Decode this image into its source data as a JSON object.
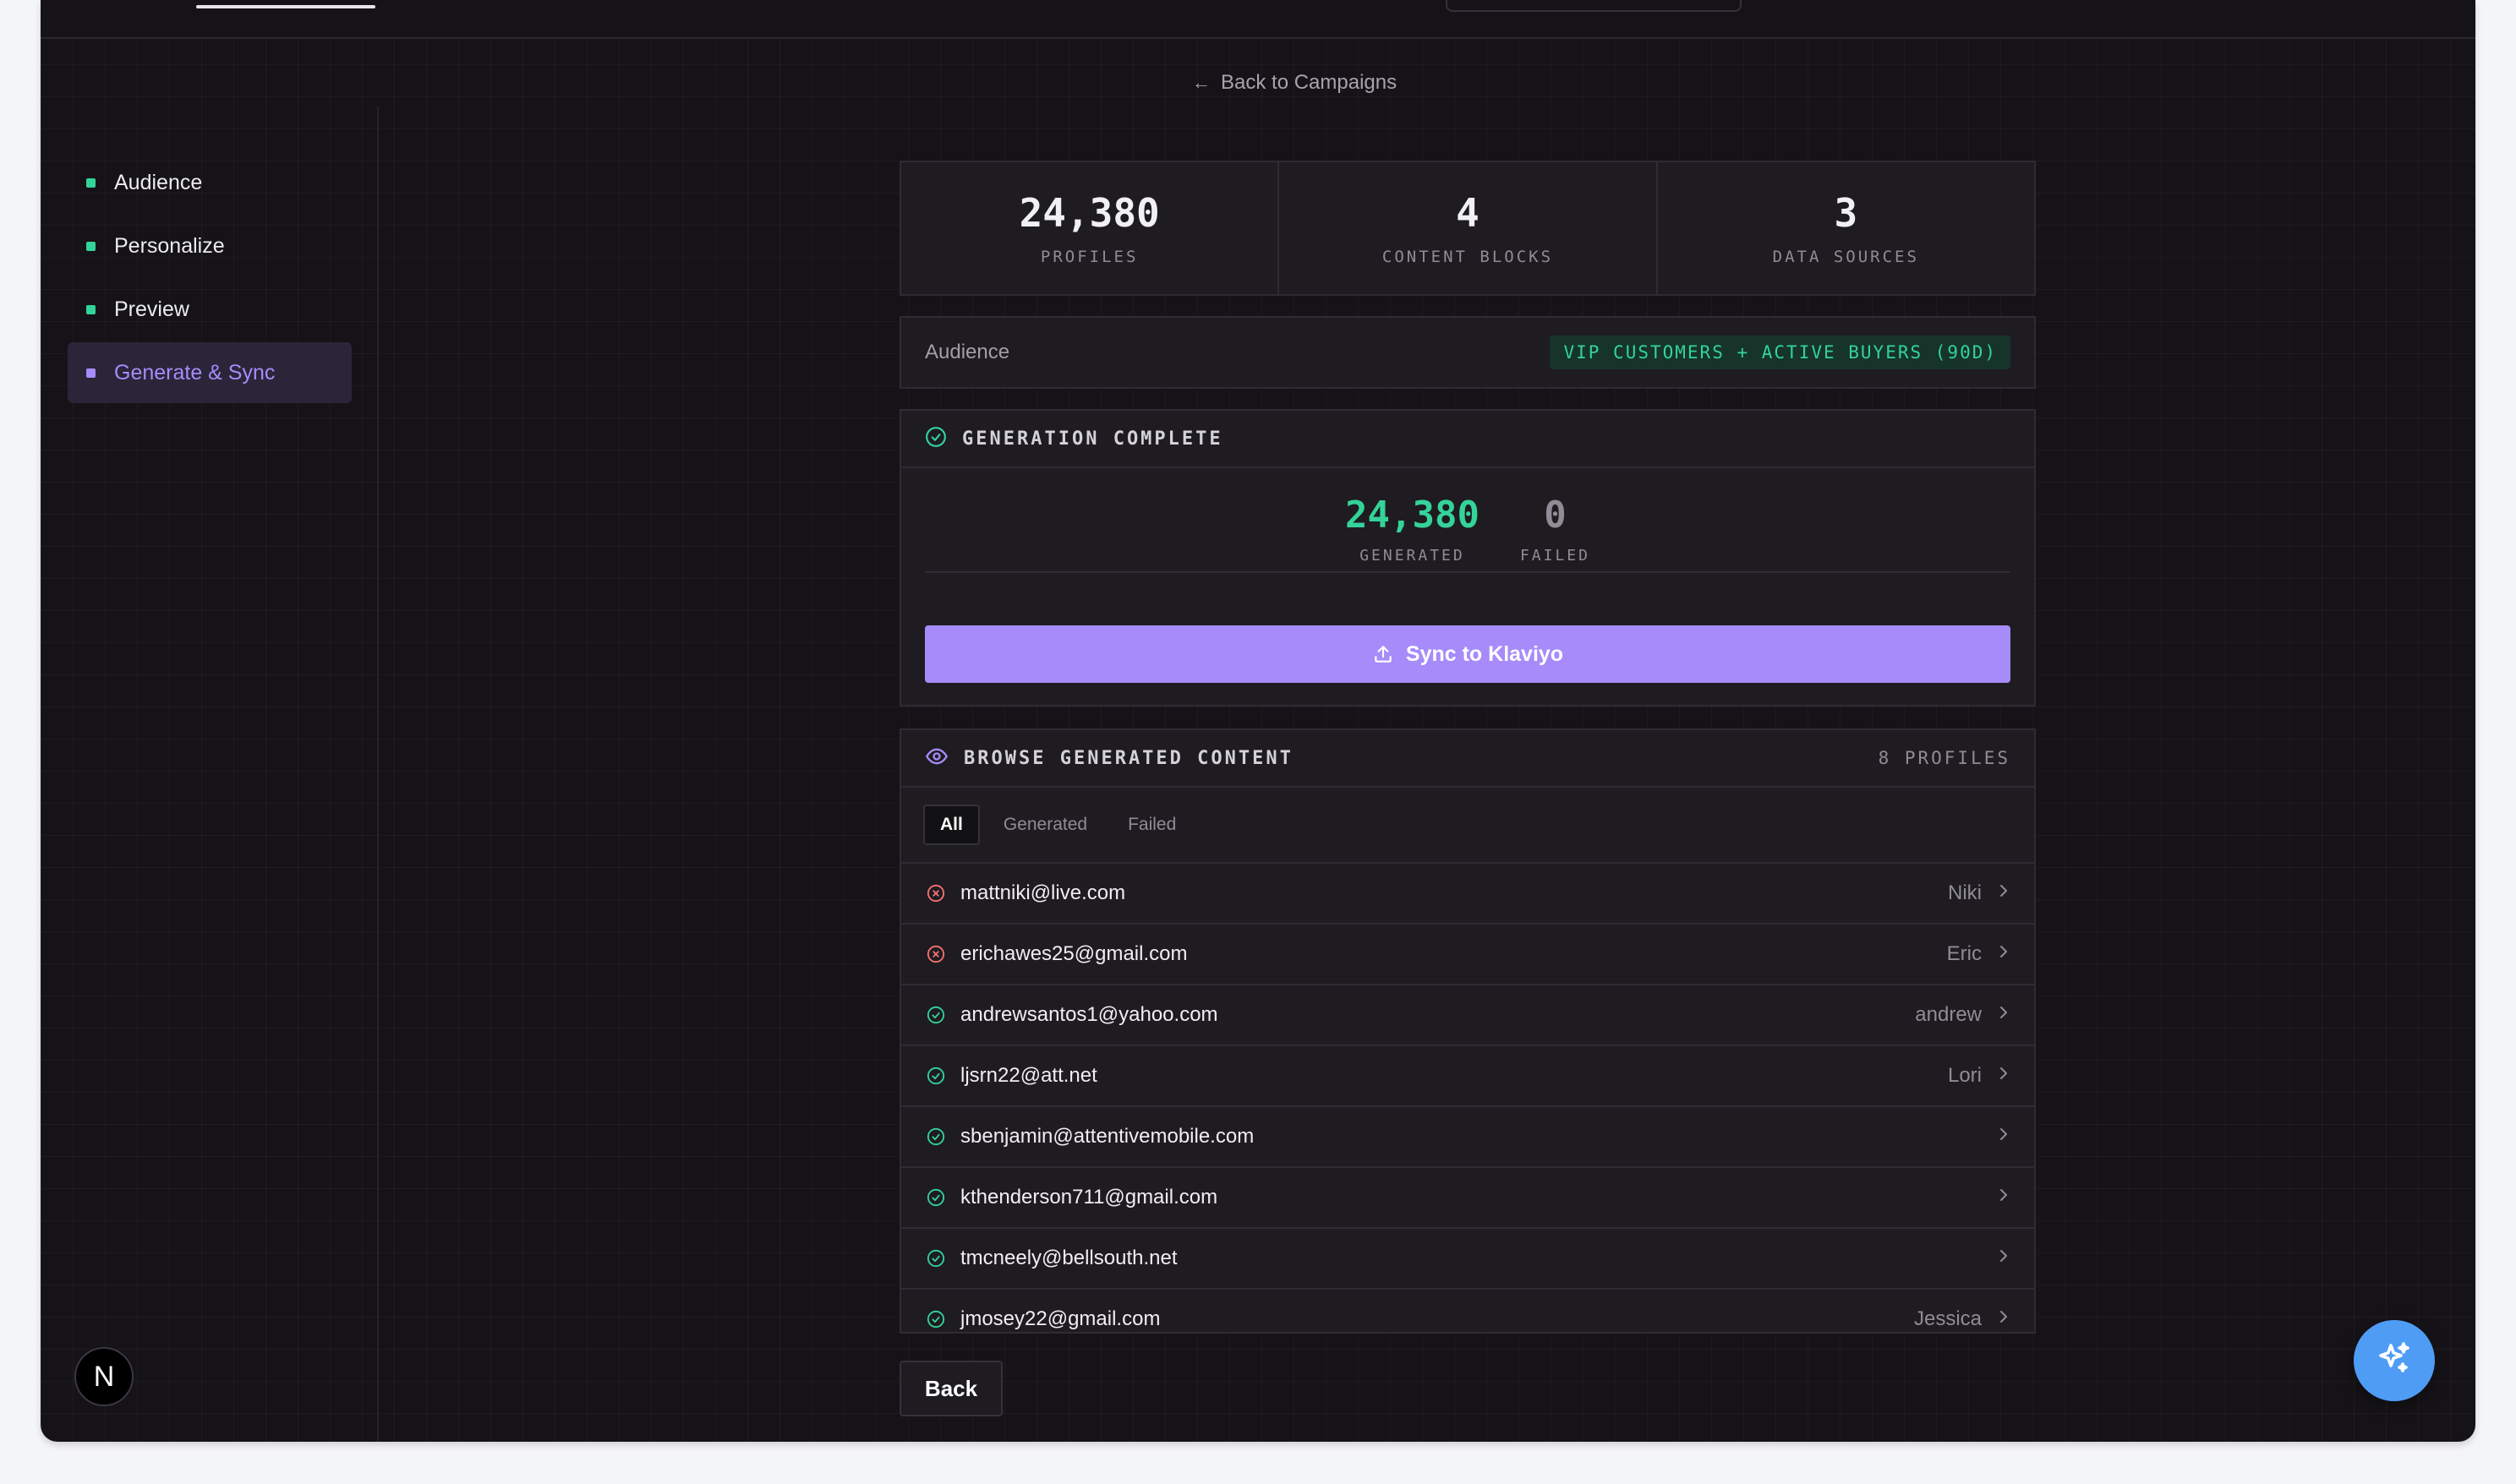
{
  "nav": {
    "back_link": "Back to Campaigns",
    "steps": [
      {
        "label": "Audience"
      },
      {
        "label": "Personalize"
      },
      {
        "label": "Preview"
      },
      {
        "label": "Generate & Sync"
      }
    ],
    "active_step": "Generate & Sync"
  },
  "stats": [
    {
      "value": "24,380",
      "label": "PROFILES"
    },
    {
      "value": "4",
      "label": "CONTENT BLOCKS"
    },
    {
      "value": "3",
      "label": "DATA SOURCES"
    }
  ],
  "audience": {
    "label": "Audience",
    "badge": "VIP CUSTOMERS + ACTIVE BUYERS (90D)"
  },
  "generation": {
    "title": "GENERATION COMPLETE",
    "generated_value": "24,380",
    "generated_label": "GENERATED",
    "failed_value": "0",
    "failed_label": "FAILED",
    "sync_button": "Sync to Klaviyo"
  },
  "browse": {
    "title": "BROWSE GENERATED CONTENT",
    "count": "8 PROFILES",
    "filters": [
      "All",
      "Generated",
      "Failed"
    ],
    "active_filter": "All",
    "rows": [
      {
        "email": "mattniki@live.com",
        "name": "Niki",
        "status": "failed"
      },
      {
        "email": "erichawes25@gmail.com",
        "name": "Eric",
        "status": "failed"
      },
      {
        "email": "andrewsantos1@yahoo.com",
        "name": "andrew",
        "status": "generated"
      },
      {
        "email": "ljsrn22@att.net",
        "name": "Lori",
        "status": "generated"
      },
      {
        "email": "sbenjamin@attentivemobile.com",
        "name": "",
        "status": "generated"
      },
      {
        "email": "kthenderson711@gmail.com",
        "name": "",
        "status": "generated"
      },
      {
        "email": "tmcneely@bellsouth.net",
        "name": "",
        "status": "generated"
      },
      {
        "email": "jmosey22@gmail.com",
        "name": "Jessica",
        "status": "generated"
      }
    ]
  },
  "footer": {
    "back_button": "Back",
    "badge_letter": "N"
  },
  "colors": {
    "accent_purple": "#a78bfa",
    "success_green": "#34d399",
    "error_red": "#f87171",
    "fab_blue": "#4f9cf5",
    "background": "#151317"
  },
  "icons": {
    "back": "arrow-left-icon",
    "generation": "check-circle-icon",
    "sync": "upload-icon",
    "browse": "eye-icon",
    "row_failed": "x-circle-icon",
    "row_generated": "check-circle-icon",
    "row_open": "chevron-right-icon",
    "fab": "sparkle-icon"
  }
}
